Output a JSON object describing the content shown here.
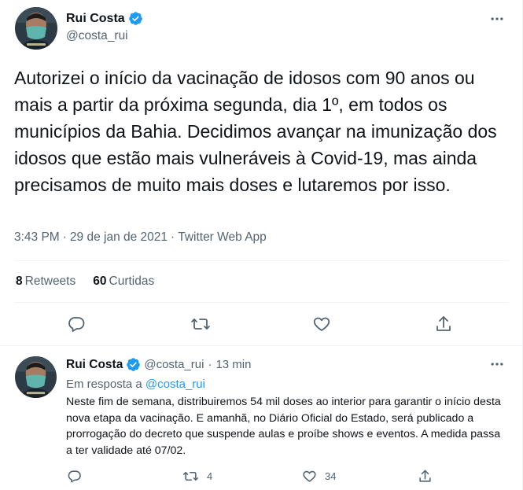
{
  "main_tweet": {
    "author_name": "Rui Costa",
    "handle": "@costa_rui",
    "text": "Autorizei o início da vacinação de idosos com 90 anos ou mais a partir da próxima segunda, dia 1º, em todos os municípios da Bahia. Decidimos avançar na imunização dos idosos que estão mais vulneráveis à Covid-19, mas ainda precisamos de muito mais doses e lutaremos por isso.",
    "time": "3:43 PM",
    "date": "29 de jan de 2021",
    "separator": "·",
    "source": "Twitter Web App",
    "retweets_count": "8",
    "retweets_label": "Retweets",
    "likes_count": "60",
    "likes_label": "Curtidas"
  },
  "reply_tweet": {
    "author_name": "Rui Costa",
    "handle": "@costa_rui",
    "separator": "·",
    "time_ago": "13 min",
    "reply_prefix": "Em resposta a",
    "reply_to_handle": "@costa_rui",
    "text": "Neste fim de semana, distribuiremos 54 mil doses ao interior para garantir o início desta nova etapa da vacinação. E amanhã, no Diário Oficial do Estado, será publicado a prorrogação do decreto que suspende aulas e proíbe shows e eventos. A medida passa a ter validade até 07/02.",
    "retweet_count": "4",
    "like_count": "34"
  },
  "icons": {
    "reply": "reply-icon",
    "retweet": "retweet-icon",
    "like": "heart-icon",
    "share": "share-icon",
    "more": "more-icon",
    "verified": "verified-badge-icon"
  },
  "colors": {
    "accent": "#1d9bf0",
    "secondary_text": "#536471",
    "primary_text": "#0f1419",
    "border": "#eff3f4",
    "mask": "#5fb5ad"
  }
}
